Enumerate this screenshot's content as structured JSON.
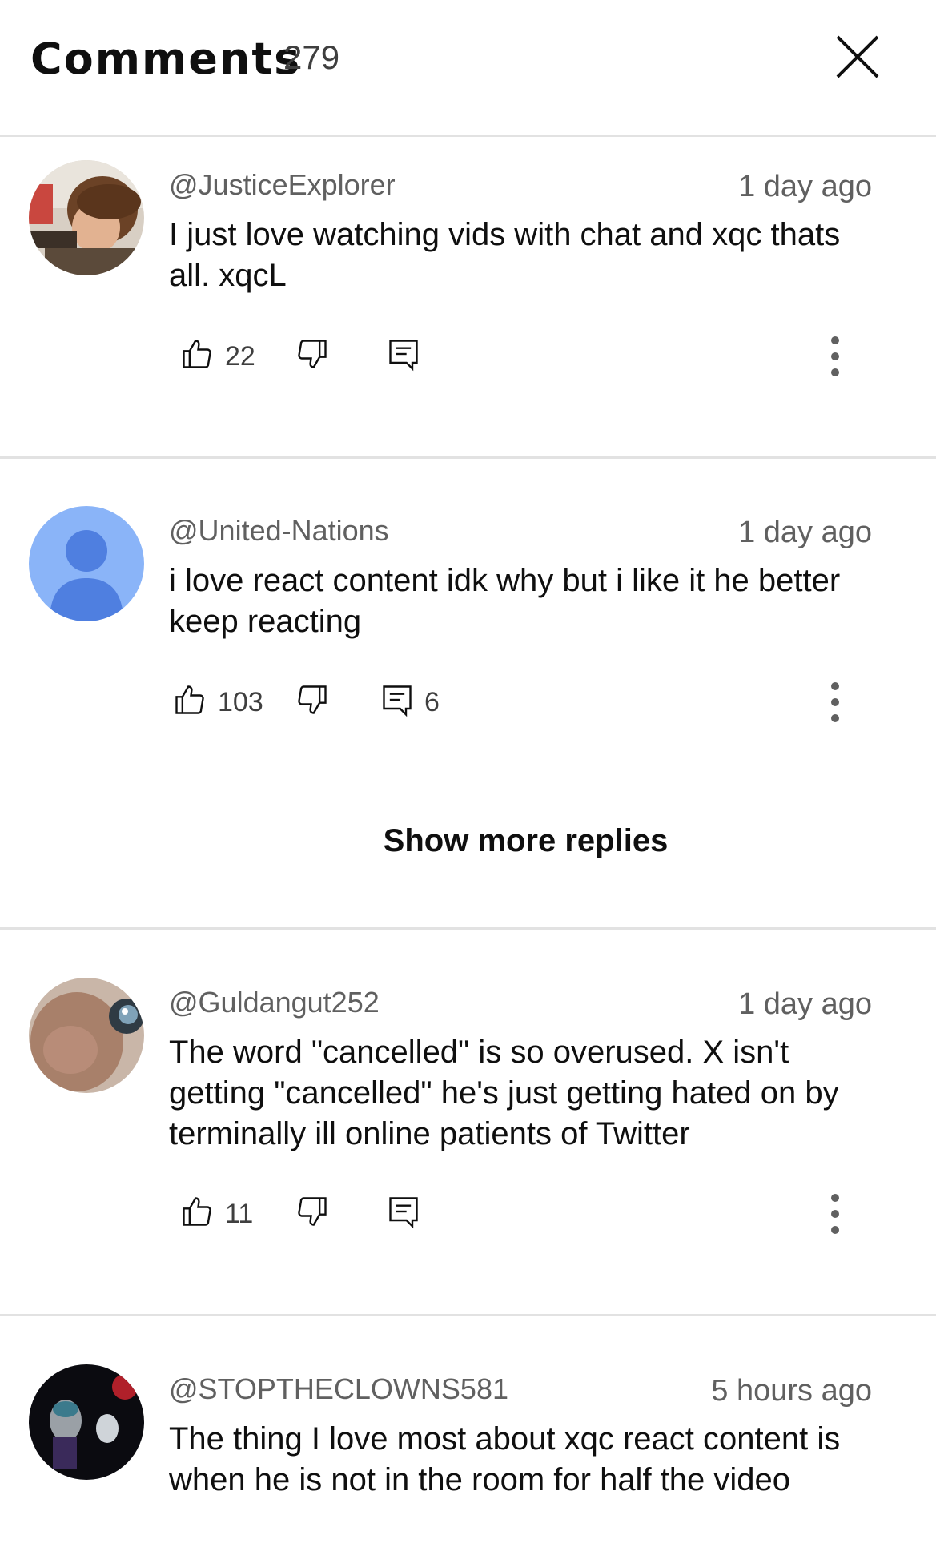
{
  "header": {
    "title": "Comments",
    "count": "279"
  },
  "comments": [
    {
      "author": "@JusticeExplorer",
      "time": "1 day ago",
      "text": "I just love watching vids with chat and xqc thats all. xqcL",
      "likes": "22",
      "replies": ""
    },
    {
      "author": "@United-Nations",
      "time": "1 day ago",
      "text": "i love react content idk why but i like it he better keep reacting",
      "likes": "103",
      "replies": "6"
    },
    {
      "author": "@Guldangut252",
      "time": "1 day ago",
      "text": "The word \"cancelled\" is so overused. X isn't getting \"cancelled\" he's just getting hated on by terminally ill online patients of Twitter",
      "likes": "11",
      "replies": ""
    },
    {
      "author": "@STOPTHECLOWNS581",
      "time": "5 hours ago",
      "text": "The thing I love most about xqc react content is when he is not in the room for half the video",
      "likes": "",
      "replies": ""
    }
  ],
  "show_more_replies": "Show more replies",
  "icons": {
    "close": "close-icon",
    "like": "thumbs-up-icon",
    "dislike": "thumbs-down-icon",
    "reply": "reply-icon",
    "more": "more-vert-icon"
  },
  "colors": {
    "default_avatar_bg": "#8ab4f8",
    "default_avatar_fg": "#4f7fe0"
  }
}
